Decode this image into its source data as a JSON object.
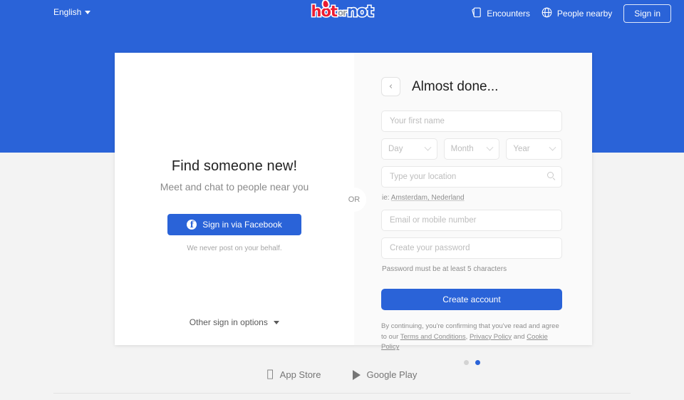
{
  "header": {
    "language": "English",
    "logo": {
      "part1": "hot",
      "part2": "or",
      "part3": "not"
    },
    "nav": [
      {
        "label": "Encounters",
        "icon": "cards-icon"
      },
      {
        "label": "People nearby",
        "icon": "globe-icon"
      }
    ],
    "sign_in_label": "Sign in"
  },
  "left_panel": {
    "headline": "Find someone new!",
    "subhead": "Meet and chat to people near you",
    "facebook_button": "Sign in via Facebook",
    "facebook_note": "We never post on your behalf.",
    "other_options": "Other sign in options",
    "divider_label": "OR"
  },
  "form": {
    "back_icon": "‹",
    "title": "Almost done...",
    "first_name_placeholder": "Your first name",
    "first_name_value": "",
    "dob": [
      {
        "label": "Day"
      },
      {
        "label": "Month"
      },
      {
        "label": "Year"
      }
    ],
    "location_placeholder": "Type your location",
    "location_value": "",
    "location_hint_prefix": "ie: ",
    "location_hint_link": "Amsterdam, Nederland",
    "email_placeholder": "Email or mobile number",
    "email_value": "",
    "password_placeholder": "Create your password",
    "password_value": "",
    "password_hint": "Password must be at least 5 characters",
    "submit_label": "Create account",
    "legal_intro": "By continuing, you're confirming that you've read and agree to our ",
    "legal_terms": "Terms and Conditions",
    "legal_sep1": ", ",
    "legal_privacy": "Privacy Policy",
    "legal_sep2": " and ",
    "legal_cookie": "Cookie Policy",
    "dots": [
      {
        "active": false
      },
      {
        "active": true
      }
    ]
  },
  "footer": {
    "app_store": "App Store",
    "google_play": "Google Play"
  },
  "colors": {
    "brand_blue": "#2a63d8",
    "logo_red": "#ec1c32",
    "page_bg": "#f3f3f3"
  }
}
